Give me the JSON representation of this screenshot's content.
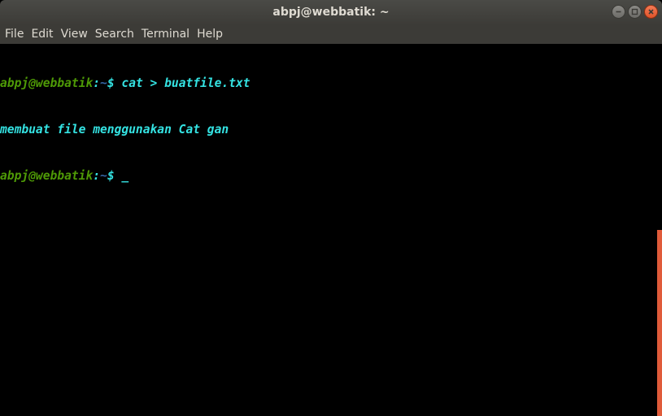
{
  "window": {
    "title": "abpj@webbatik: ~"
  },
  "menu": {
    "items": [
      "File",
      "Edit",
      "View",
      "Search",
      "Terminal",
      "Help"
    ]
  },
  "terminal": {
    "lines": [
      {
        "user": "abpj@webbatik",
        "colon": ":",
        "path": "~",
        "prompt": "$ ",
        "text": "cat > buatfile.txt"
      },
      {
        "text": "membuat file menggunakan Cat gan"
      },
      {
        "user": "abpj@webbatik",
        "colon": ":",
        "path": "~",
        "prompt": "$ ",
        "cursor": "_"
      }
    ]
  },
  "scrollbar": {
    "position_fraction": 0.5,
    "visible_fraction": 0.5
  },
  "colors": {
    "user": "#4e9a06",
    "path": "#3465a4",
    "text": "#34e2e2",
    "accent": "#e05b3a"
  }
}
